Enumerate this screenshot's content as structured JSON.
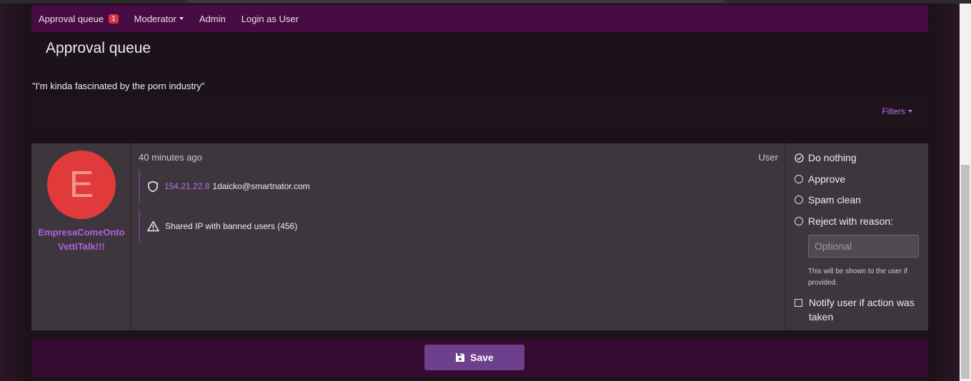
{
  "nav": {
    "items": [
      {
        "label": "Approval queue",
        "badge": "1"
      },
      {
        "label": "Moderator"
      },
      {
        "label": "Admin"
      },
      {
        "label": "Login as User"
      }
    ]
  },
  "page": {
    "title": "Approval queue",
    "quote": "\"I'm kinda fascinated by the porn industry\"",
    "filters_label": "Filters"
  },
  "entry": {
    "avatar_letter": "E",
    "username": "EmpresaComeOntoVettiTalk!!!",
    "time_ago": "40 minutes ago",
    "content_type": "User",
    "ip": "154.21.22.8",
    "email": "1daicko@smartnator.com",
    "warning": "Shared IP with banned users (456)",
    "actions": {
      "do_nothing": "Do nothing",
      "approve": "Approve",
      "spam_clean": "Spam clean",
      "reject": "Reject with reason:",
      "reason_placeholder": "Optional",
      "reason_hint": "This will be shown to the user if provided.",
      "notify": "Notify user if action was taken"
    }
  },
  "footer": {
    "save_label": "Save"
  },
  "colors": {
    "navbar": "#480c45",
    "accent_link": "#b96ee6",
    "avatar_bg": "#e03a3a",
    "save_button": "#6d3f8d"
  }
}
